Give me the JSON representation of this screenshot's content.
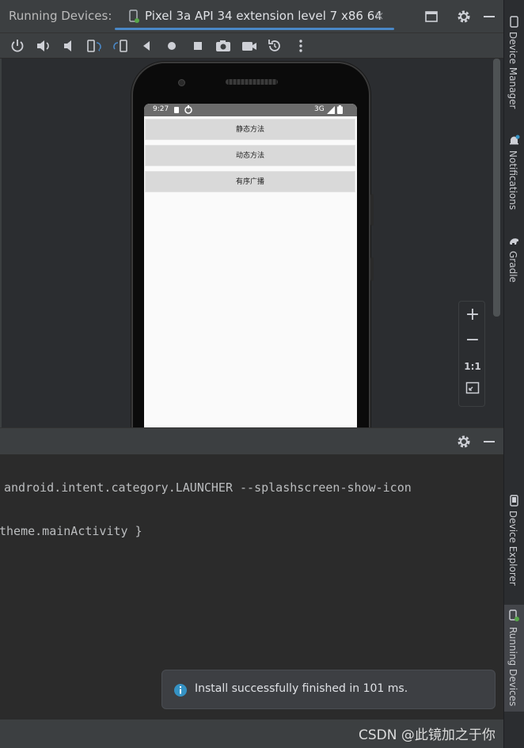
{
  "tool_window": {
    "title": "Running Devices:",
    "tab_label": "Pixel 3a API 34 extension level 7 x86 64",
    "tab_close": "×"
  },
  "toolbar": {
    "icons": [
      "power-icon",
      "volume-up-icon",
      "volume-down-icon",
      "rotate-left-icon",
      "rotate-right-icon",
      "back-icon",
      "home-icon",
      "overview-icon",
      "screenshot-icon",
      "screen-record-icon",
      "reset-icon",
      "more-icon"
    ]
  },
  "emulator": {
    "status_time": "9:27",
    "status_network": "3G",
    "buttons": [
      "静态方法",
      "动态方法",
      "有序广播"
    ]
  },
  "zoom": {
    "zoom_in": "+",
    "zoom_out": "−",
    "actual_size": "1:1"
  },
  "log": {
    "lines": [
      "android.intent.category.LAUNCHER --splashscreen-show-icon",
      "theme.mainActivity }"
    ]
  },
  "notification": {
    "text": "Install successfully finished in 101 ms."
  },
  "right_sidebar": {
    "items": [
      {
        "label": "Device Manager",
        "icon": "device-manager-icon"
      },
      {
        "label": "Notifications",
        "icon": "bell-icon"
      },
      {
        "label": "Gradle",
        "icon": "gradle-icon"
      },
      {
        "label": "Device Explorer",
        "icon": "device-explorer-icon"
      },
      {
        "label": "Running Devices",
        "icon": "running-devices-icon"
      }
    ]
  },
  "watermark": "CSDN @此镜加之于你",
  "colors": {
    "accent": "#4a88c7",
    "background": "#2b2d30",
    "panel": "#3c3f41"
  }
}
